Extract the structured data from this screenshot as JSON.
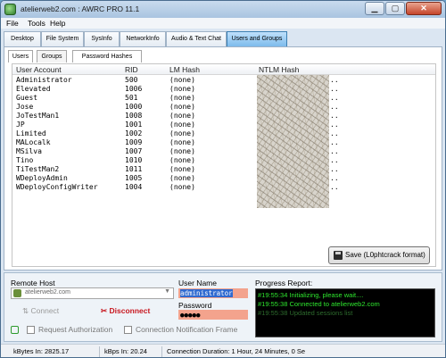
{
  "window": {
    "title": "atelierweb2.com : AWRC PRO 11.1",
    "minimize": "▁",
    "maximize": "▢",
    "close": "✕"
  },
  "menu": [
    "File",
    "Tools",
    "Help"
  ],
  "tabs": [
    {
      "label": "Desktop"
    },
    {
      "label": "File System"
    },
    {
      "label": "SysInfo"
    },
    {
      "label": "NetworkInfo"
    },
    {
      "label": "Audio & Text Chat"
    },
    {
      "label": "Users and Groups",
      "active": true
    }
  ],
  "subtabs": [
    {
      "label": "Users",
      "active": true
    },
    {
      "label": "Groups"
    },
    {
      "label": "Password Hashes",
      "active": true
    }
  ],
  "table": {
    "columns": [
      "User Account",
      "RID",
      "LM Hash",
      "NTLM Hash"
    ],
    "rows": [
      {
        "account": "Administrator",
        "rid": "500",
        "lm": "(none)",
        "ntlm_tail": ".."
      },
      {
        "account": "Elevated",
        "rid": "1006",
        "lm": "(none)",
        "ntlm_tail": ".."
      },
      {
        "account": "Guest",
        "rid": "501",
        "lm": "(none)",
        "ntlm_tail": ".."
      },
      {
        "account": "Jose",
        "rid": "1000",
        "lm": "(none)",
        "ntlm_tail": ".."
      },
      {
        "account": "JoTestMan1",
        "rid": "1008",
        "lm": "(none)",
        "ntlm_tail": ".."
      },
      {
        "account": "JP",
        "rid": "1001",
        "lm": "(none)",
        "ntlm_tail": ".."
      },
      {
        "account": "Limited",
        "rid": "1002",
        "lm": "(none)",
        "ntlm_tail": ".."
      },
      {
        "account": "MALocalk",
        "rid": "1009",
        "lm": "(none)",
        "ntlm_tail": ".."
      },
      {
        "account": "MSilva",
        "rid": "1007",
        "lm": "(none)",
        "ntlm_tail": ".."
      },
      {
        "account": "Tino",
        "rid": "1010",
        "lm": "(none)",
        "ntlm_tail": ".."
      },
      {
        "account": "TiTestMan2",
        "rid": "1011",
        "lm": "(none)",
        "ntlm_tail": ".."
      },
      {
        "account": "WDeployAdmin",
        "rid": "1005",
        "lm": "(none)",
        "ntlm_tail": ".."
      },
      {
        "account": "WDeployConfigWriter",
        "rid": "1004",
        "lm": "(none)",
        "ntlm_tail": ".."
      }
    ]
  },
  "save_button": {
    "label": "Save (L0phtcrack format)"
  },
  "connection": {
    "remote_host_label": "Remote Host",
    "remote_host_value": "atelierweb2.com",
    "connect_label": "Connect",
    "disconnect_label": "Disconnect",
    "request_auth_label": "Request Authorization",
    "notification_frame_label": "Connection Notification Frame"
  },
  "credentials": {
    "user_label": "User Name",
    "user_value": "administrator",
    "password_label": "Password",
    "password_value": "●●●●●"
  },
  "progress": {
    "label": "Progress Report:",
    "lines": [
      "#19:55:34 Initializing, please wait....",
      "#19:55:38 Connected to atelierweb2.com",
      "#19:55:38 Updated sessions list"
    ]
  },
  "status": {
    "kbytes_in": "kBytes In:  2825.17",
    "kbps_in": "kBps In:  20.24",
    "duration": "Connection Duration:  1 Hour, 24 Minutes, 0 Se"
  },
  "colors": {
    "active_tab": "#7dbbec",
    "disconnect": "#c8171f",
    "console_text": "#2ee62e",
    "input_bg": "#f3a38d"
  }
}
